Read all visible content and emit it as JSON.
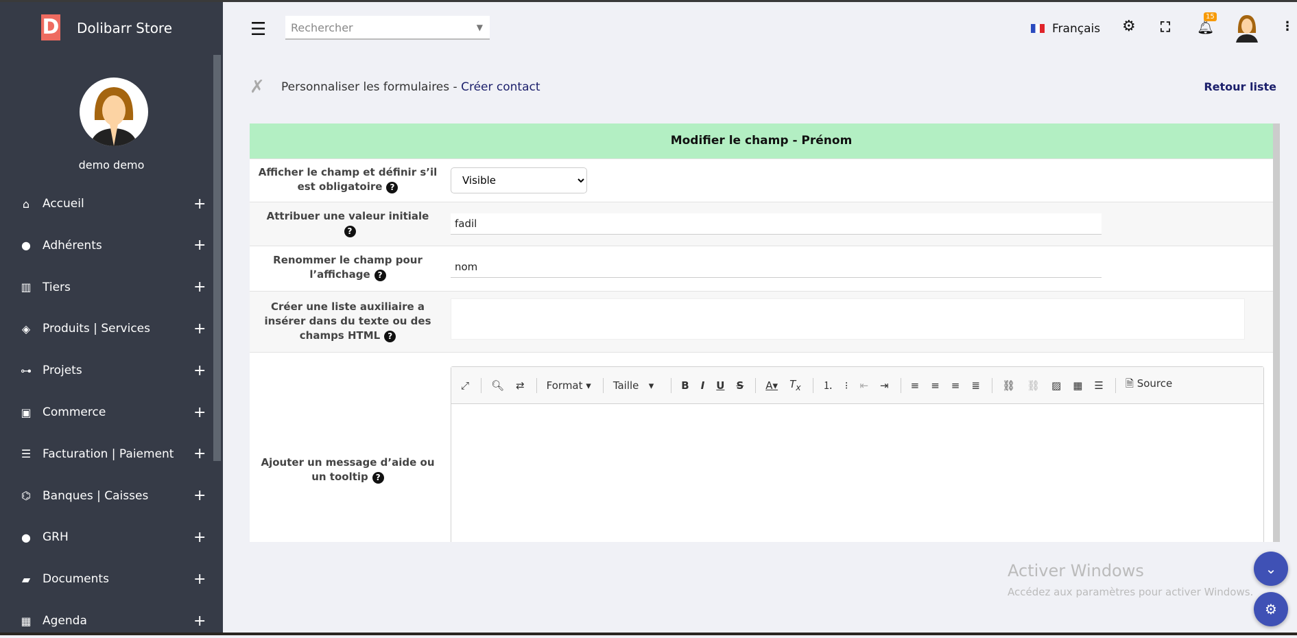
{
  "app": {
    "brand": "Dolibarr Store",
    "logo_letter": "D",
    "user": "demo demo"
  },
  "sidebar": {
    "items": [
      {
        "label": "Accueil",
        "icon": "home-icon",
        "glyph": "⌂"
      },
      {
        "label": "Adhérents",
        "icon": "user-icon",
        "glyph": "●"
      },
      {
        "label": "Tiers",
        "icon": "building-icon",
        "glyph": "▥"
      },
      {
        "label": "Produits | Services",
        "icon": "cube-icon",
        "glyph": "◈"
      },
      {
        "label": "Projets",
        "icon": "sitemap-icon",
        "glyph": "⊶"
      },
      {
        "label": "Commerce",
        "icon": "briefcase-icon",
        "glyph": "▣"
      },
      {
        "label": "Facturation | Paiement",
        "icon": "coins-icon",
        "glyph": "☰"
      },
      {
        "label": "Banques | Caisses",
        "icon": "bank-icon",
        "glyph": "⌬"
      },
      {
        "label": "GRH",
        "icon": "user-tie-icon",
        "glyph": "●"
      },
      {
        "label": "Documents",
        "icon": "folder-icon",
        "glyph": "▰"
      },
      {
        "label": "Agenda",
        "icon": "calendar-icon",
        "glyph": "▦"
      }
    ],
    "plus": "+"
  },
  "topbar": {
    "search_placeholder": "Rechercher",
    "language": "Français",
    "notifications": "15"
  },
  "page": {
    "title": "Personnaliser les formulaires - ",
    "title_link": "Créer contact",
    "back": "Retour liste"
  },
  "form": {
    "header": "Modifier le champ - Prénom",
    "rows": [
      {
        "label": "Afficher le champ et définir s’il est obligatoire",
        "value": "Visible"
      },
      {
        "label": "Attribuer une valeur initiale",
        "value": "fadil"
      },
      {
        "label": "Renommer le champ pour l’affichage",
        "value": "nom"
      },
      {
        "label": "Créer une liste auxiliaire a insérer dans du texte ou des champs HTML",
        "value": ""
      },
      {
        "label": "Ajouter un message d’aide ou un tooltip"
      }
    ],
    "help": "?"
  },
  "editor": {
    "format": "Format",
    "size": "Taille",
    "source": "Source"
  },
  "watermark": {
    "title": "Activer Windows",
    "subtitle": "Accédez aux paramètres pour activer Windows."
  }
}
